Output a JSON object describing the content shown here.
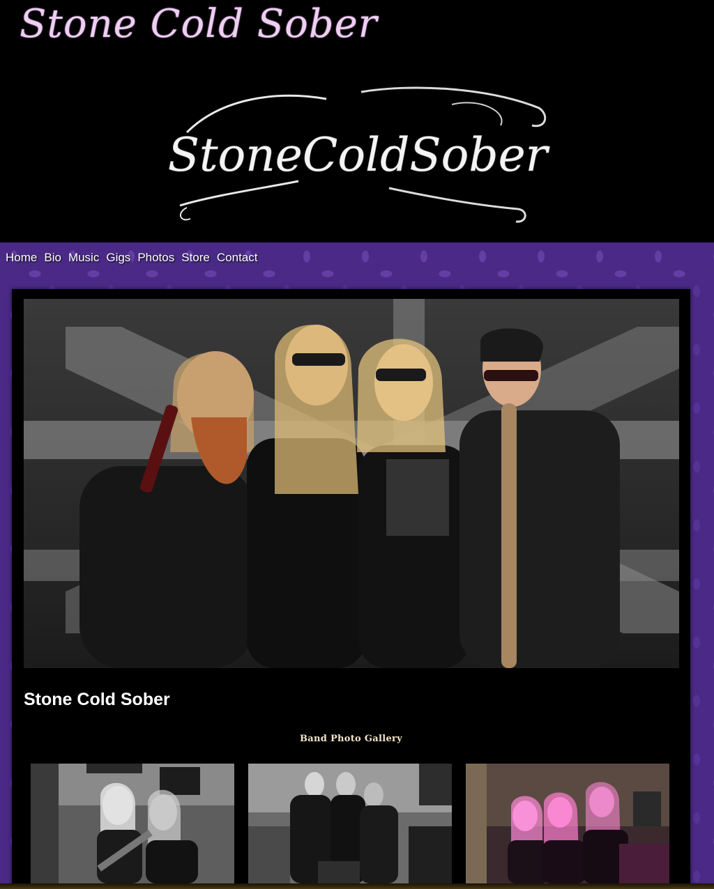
{
  "header": {
    "site_title": "Stone Cold Sober",
    "logo_text": "StoneColdSober"
  },
  "nav": {
    "items": [
      "Home",
      "Bio",
      "Music",
      "Gigs",
      "Photos",
      "Store",
      "Contact"
    ]
  },
  "main": {
    "heading": "Stone Cold Sober",
    "gallery_heading": "Band Photo Gallery"
  },
  "colors": {
    "title_pink": "#eecff2",
    "background_purple": "#4a2a86",
    "panel_black": "#000000",
    "gallery_heading_cream": "#f2e3c7"
  }
}
